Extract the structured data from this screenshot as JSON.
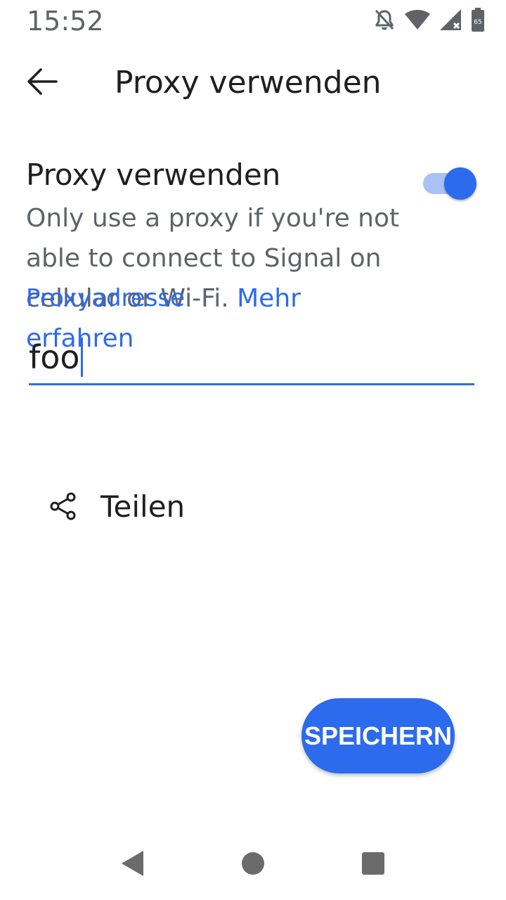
{
  "status_bar": {
    "time": "15:52",
    "icons": [
      "bell-off-icon",
      "wifi-icon",
      "signal-icon",
      "battery-icon"
    ],
    "battery_level": "65"
  },
  "app_bar": {
    "title": "Proxy verwenden",
    "back_icon": "arrow-left-icon"
  },
  "proxy_toggle": {
    "title": "Proxy verwenden",
    "summary": "Only use a proxy if you're not able to connect to Signal on cellular or Wi-Fi.",
    "learn_more": "Mehr erfahren",
    "enabled": true
  },
  "address_field": {
    "label": "Proxyadresse",
    "value": "foo"
  },
  "share": {
    "icon": "share-icon",
    "label": "Teilen"
  },
  "save_button": {
    "label": "SPEICHERN"
  },
  "nav_bar": {
    "icons": [
      "back-triangle-icon",
      "home-circle-icon",
      "recents-square-icon"
    ]
  },
  "colors": {
    "accent": "#2c6bed",
    "switch_track": "#a9c1f7",
    "secondary_text": "#5f6368",
    "primary_text": "#1f1f1f"
  }
}
